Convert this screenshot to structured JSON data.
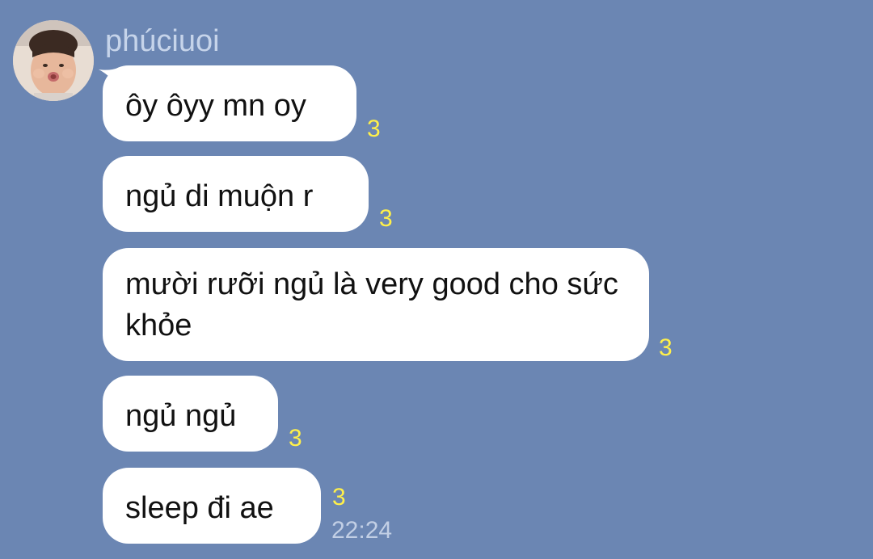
{
  "sender": {
    "name": "phúciuoi"
  },
  "messages": [
    {
      "text": "ôy ôyy mn oy",
      "read_count": "3"
    },
    {
      "text": "ngủ di muộn r",
      "read_count": "3"
    },
    {
      "text": "mười rưỡi ngủ là very good cho sức khỏe",
      "read_count": "3"
    },
    {
      "text": "ngủ ngủ",
      "read_count": "3"
    },
    {
      "text": "sleep đi ae",
      "read_count": "3",
      "time": "22:24"
    }
  ],
  "colors": {
    "background": "#6b86b3",
    "bubble": "#ffffff",
    "read_count": "#fff04a",
    "sender_name": "#c6d4ea",
    "timestamp": "#c2cfe5"
  },
  "icons": {
    "avatar": "profile-photo"
  }
}
